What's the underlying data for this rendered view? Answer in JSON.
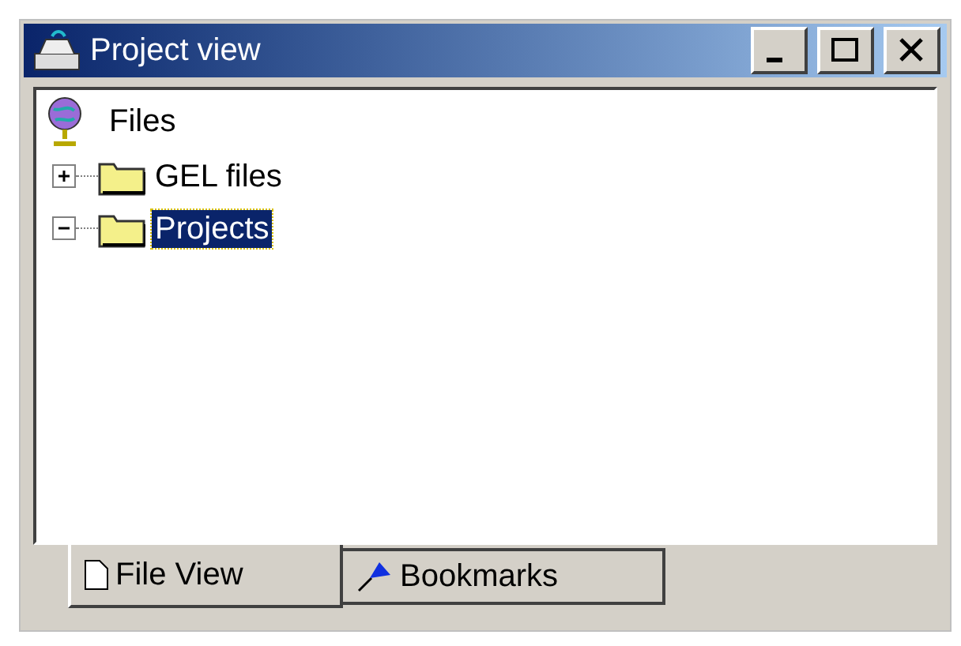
{
  "window": {
    "title": "Project view"
  },
  "tree": {
    "label": "Files",
    "selected": false,
    "children": [
      {
        "label": "GEL files",
        "expanded": false,
        "selected": false
      },
      {
        "label": "Projects",
        "expanded": true,
        "selected": true
      }
    ]
  },
  "tabs": [
    {
      "label": "File View",
      "selected": true,
      "kind": "file"
    },
    {
      "label": "Bookmarks",
      "selected": false,
      "kind": "bookmark"
    }
  ]
}
